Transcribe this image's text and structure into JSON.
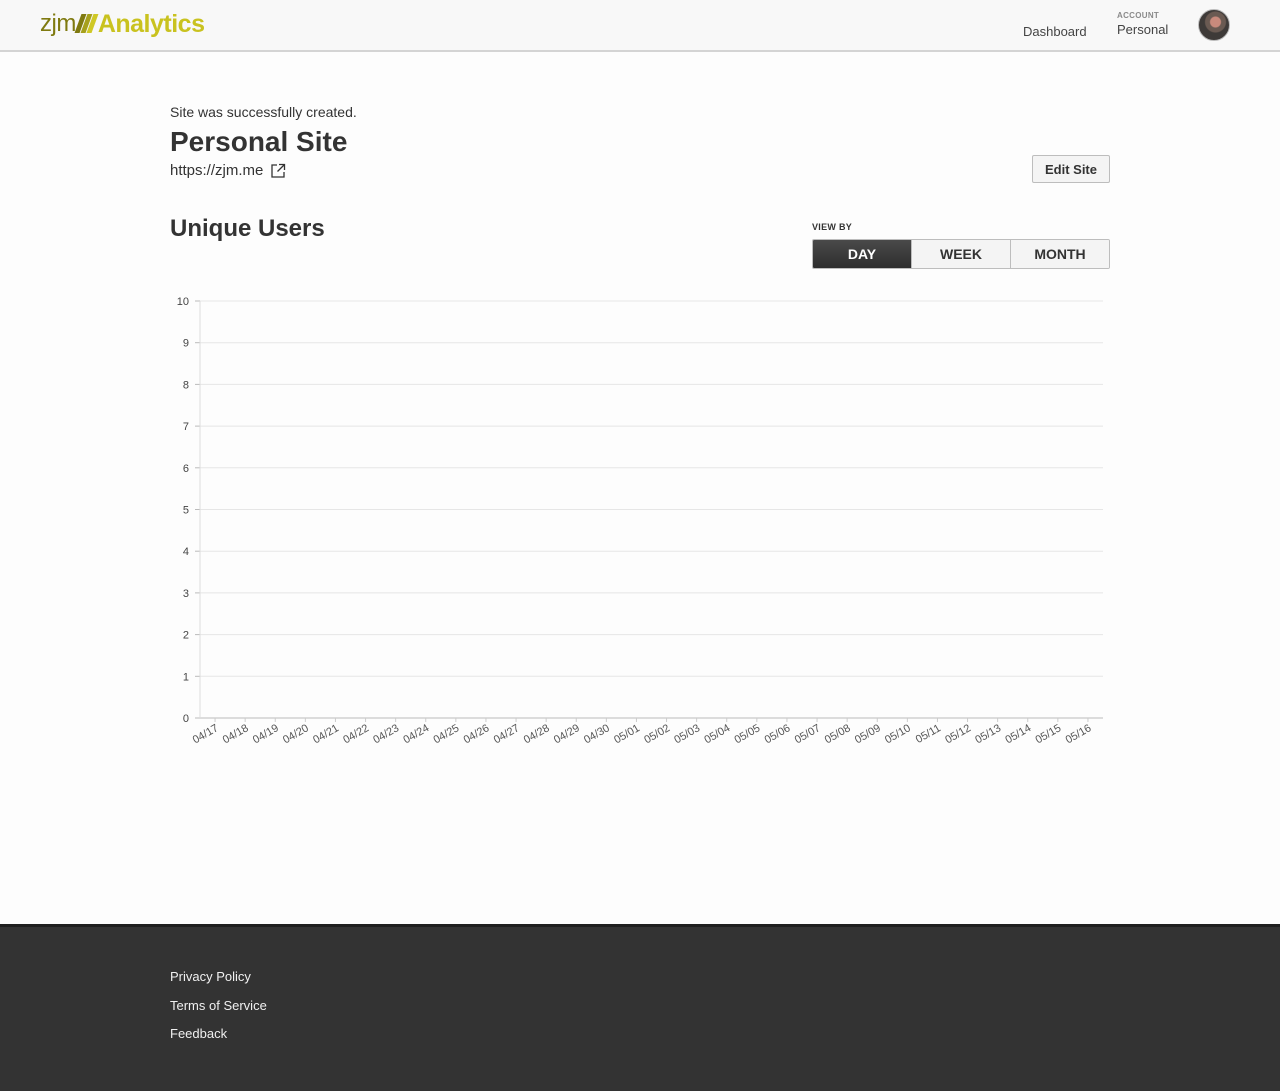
{
  "header": {
    "brand_prefix": "zjm",
    "brand_name": "Analytics",
    "nav_dashboard": "Dashboard",
    "account_label": "ACCOUNT",
    "account_value": "Personal"
  },
  "flash": "Site was successfully created.",
  "site": {
    "title": "Personal Site",
    "url": "https://zjm.me",
    "edit_label": "Edit Site"
  },
  "section_title": "Unique Users",
  "view_by": {
    "label": "VIEW BY",
    "options": [
      "DAY",
      "WEEK",
      "MONTH"
    ],
    "selected": "DAY"
  },
  "chart_data": {
    "type": "line",
    "title": "",
    "xlabel": "",
    "ylabel": "",
    "categories": [
      "04/17",
      "04/18",
      "04/19",
      "04/20",
      "04/21",
      "04/22",
      "04/23",
      "04/24",
      "04/25",
      "04/26",
      "04/27",
      "04/28",
      "04/29",
      "04/30",
      "05/01",
      "05/02",
      "05/03",
      "05/04",
      "05/05",
      "05/06",
      "05/07",
      "05/08",
      "05/09",
      "05/10",
      "05/11",
      "05/12",
      "05/13",
      "05/14",
      "05/15",
      "05/16"
    ],
    "yticks": [
      0,
      1,
      2,
      3,
      4,
      5,
      6,
      7,
      8,
      9,
      10
    ],
    "ylim": [
      0,
      10
    ],
    "series": [
      {
        "values": []
      }
    ],
    "grid": true
  },
  "footer": {
    "links": [
      "Privacy Policy",
      "Terms of Service",
      "Feedback"
    ]
  },
  "colors": {
    "brand_dark": "#7f7a10",
    "brand_light": "#c9c21f",
    "footer_bg": "#333333",
    "active_toggle": "#3a3a3a"
  }
}
